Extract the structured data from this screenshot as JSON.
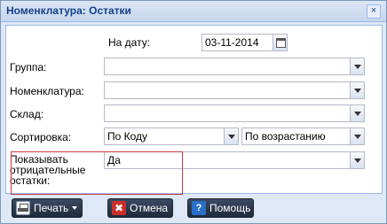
{
  "window": {
    "title": "Номенклатура: Остатки",
    "close_glyph": "×"
  },
  "form": {
    "date_label": "На дату:",
    "date_value": "03-11-2014",
    "group_label": "Группа:",
    "group_value": "",
    "nomenclature_label": "Номенклатура:",
    "nomenclature_value": "",
    "warehouse_label": "Склад:",
    "warehouse_value": "",
    "sort_label": "Сортировка:",
    "sort_by_value": "По Коду",
    "sort_order_value": "По возрастанию",
    "show_negative_label_1": "Показывать",
    "show_negative_label_2": "отрицательные",
    "show_negative_label_3": "остатки:",
    "show_negative_value": "Да"
  },
  "buttons": {
    "print_label": "Печать",
    "cancel_label": "Отмена",
    "help_label": "Помощь",
    "cancel_glyph": "✖",
    "help_glyph": "?"
  },
  "icons": {
    "print": "printer-icon",
    "cancel": "cancel-icon",
    "help": "help-icon",
    "calendar": "calendar-icon",
    "dropdown": "chevron-down-icon"
  },
  "colors": {
    "title_text": "#15428b",
    "window_bg": "#dfe8f6",
    "highlight_border": "#d0393f",
    "button_bg": "#2b374b"
  }
}
